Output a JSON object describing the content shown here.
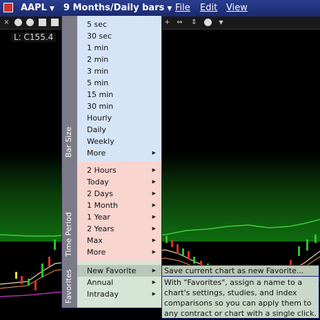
{
  "menubar": {
    "symbol": "AAPL",
    "period": "9 Months/Daily bars",
    "file": "File",
    "edit": "Edit",
    "view": "View"
  },
  "chart": {
    "price_label": "L: C155.4"
  },
  "dropdown": {
    "bar_size": {
      "label": "Bar Size",
      "items": [
        "5 sec",
        "30 sec",
        "1 min",
        "2 min",
        "3 min",
        "5 min",
        "15 min",
        "30 min",
        "Hourly",
        "Daily",
        "Weekly",
        "More"
      ]
    },
    "time_period": {
      "label": "Time Period",
      "items": [
        "2 Hours",
        "Today",
        "2 Days",
        "1 Month",
        "1 Year",
        "2 Years",
        "Max",
        "More"
      ]
    },
    "favorites": {
      "label": "Favorites",
      "items": [
        "New Favorite",
        "Annual",
        "Intraday"
      ]
    }
  },
  "favorites_info": {
    "save_line": "Save current chart as new Favorite...",
    "description": "With \"Favorites\", assign a name to a chart's settings, studies, and index comparisons so you can apply them to any contract or chart with a single click."
  },
  "colors": {
    "menubar": "#1b2a6e",
    "bar_size_bg": "#d6e4f7",
    "time_period_bg": "#f9d5cf",
    "favorites_bg": "#d6e6d6",
    "band": "#7b7b88"
  }
}
